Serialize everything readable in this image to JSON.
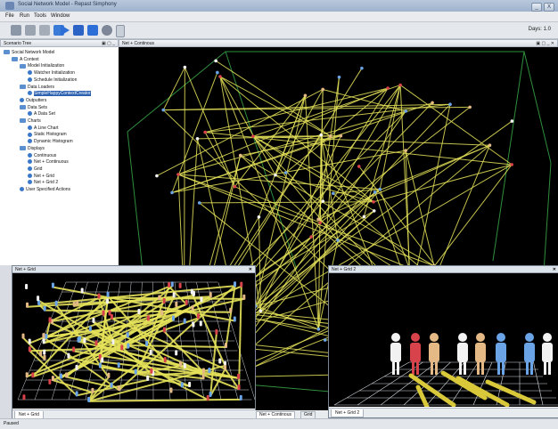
{
  "window": {
    "title": "Social Network Model - Repast Simphony",
    "min_label": "_",
    "close_label": "X"
  },
  "menu": [
    "File",
    "Run",
    "Tools",
    "Window"
  ],
  "toolbar": {
    "tick_readout": "Days: 1.0"
  },
  "tree_panel": {
    "title": "Scenario Tree",
    "items": [
      {
        "label": "Social Network Model",
        "indent": 0,
        "kind": "folder"
      },
      {
        "label": "A Context",
        "indent": 1,
        "kind": "folder"
      },
      {
        "label": "Model Initialization",
        "indent": 2,
        "kind": "folder"
      },
      {
        "label": "Watcher Initialization",
        "indent": 3,
        "kind": "leaf"
      },
      {
        "label": "Schedule Initialization",
        "indent": 3,
        "kind": "leaf"
      },
      {
        "label": "Data Loaders",
        "indent": 2,
        "kind": "folder"
      },
      {
        "label": "SimpleHappyContextCreator",
        "indent": 3,
        "kind": "leaf",
        "selected": true
      },
      {
        "label": "Outputters",
        "indent": 2,
        "kind": "leaf"
      },
      {
        "label": "Data Sets",
        "indent": 2,
        "kind": "folder"
      },
      {
        "label": "A Data Set",
        "indent": 3,
        "kind": "leaf"
      },
      {
        "label": "Charts",
        "indent": 2,
        "kind": "folder"
      },
      {
        "label": "A Line Chart",
        "indent": 3,
        "kind": "leaf"
      },
      {
        "label": "Static Histogram",
        "indent": 3,
        "kind": "leaf"
      },
      {
        "label": "Dynamic Histogram",
        "indent": 3,
        "kind": "leaf"
      },
      {
        "label": "Displays",
        "indent": 2,
        "kind": "folder"
      },
      {
        "label": "Continuous",
        "indent": 3,
        "kind": "leaf"
      },
      {
        "label": "Net + Continuous",
        "indent": 3,
        "kind": "leaf"
      },
      {
        "label": "Grid",
        "indent": 3,
        "kind": "leaf"
      },
      {
        "label": "Net + Grid",
        "indent": 3,
        "kind": "leaf"
      },
      {
        "label": "Net + Grid 2",
        "indent": 3,
        "kind": "leaf"
      },
      {
        "label": "User Specified Actions",
        "indent": 2,
        "kind": "leaf"
      }
    ]
  },
  "main_display": {
    "title": "Net + Continous"
  },
  "grid_window_1": {
    "title": "Net + Grid",
    "tab": "Net + Grid"
  },
  "grid_window_2": {
    "title": "Net + Grid 2",
    "tab": "Net + Grid 2"
  },
  "bottom_tabs": [
    "Net + Continous",
    "Grid"
  ],
  "status": {
    "text": "Paused"
  },
  "colors": {
    "link": "#e6e35a",
    "agent_blue": "#6aa3e6",
    "agent_red": "#d8424a",
    "agent_white": "#f2f2f2",
    "agent_tan": "#e5b986",
    "bounding_box": "#2f8f3d"
  }
}
